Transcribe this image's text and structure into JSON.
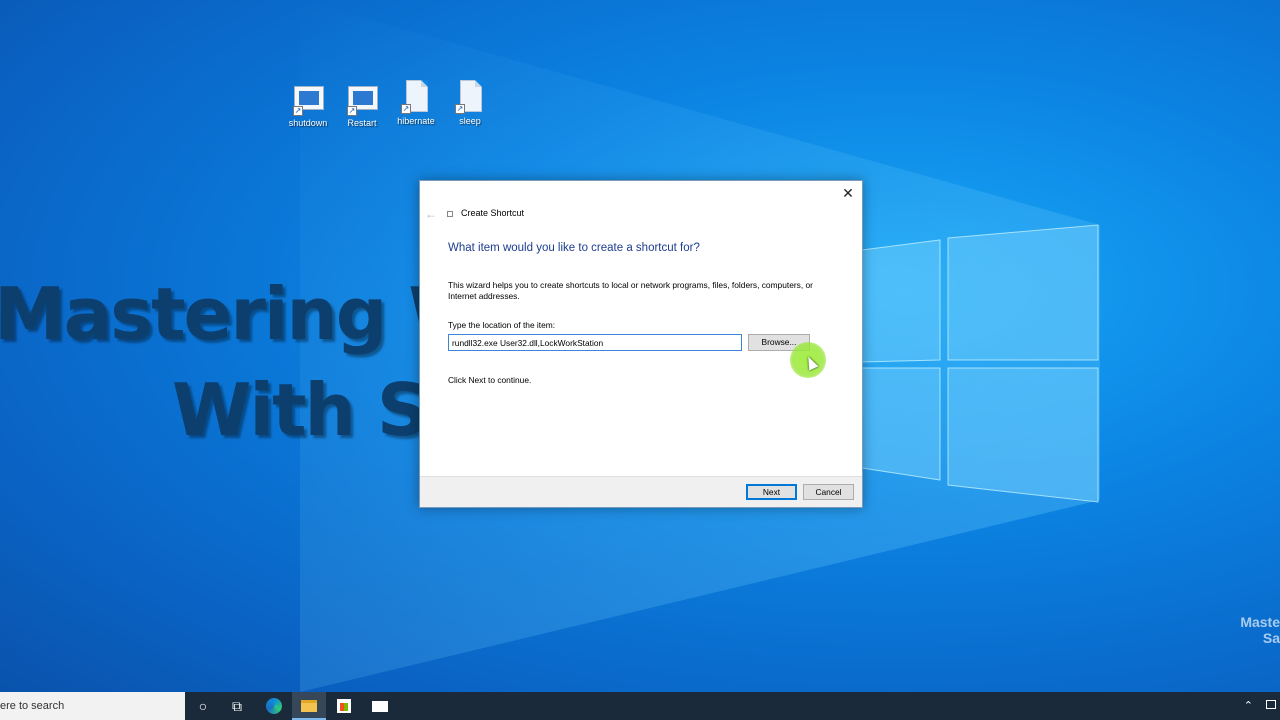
{
  "desktop": {
    "icons": [
      {
        "label": "shutdown",
        "type": "shortcut"
      },
      {
        "label": "Restart",
        "type": "shortcut"
      },
      {
        "label": "hibernate",
        "type": "file"
      },
      {
        "label": "sleep",
        "type": "file"
      }
    ],
    "overlay_line1": "Mastering Wir",
    "overlay_line2": "With Sa",
    "watermark_line1": "Maste",
    "watermark_line2": "Sa"
  },
  "dialog": {
    "title": "Create Shortcut",
    "heading": "What item would you like to create a shortcut for?",
    "description": "This wizard helps you to create shortcuts to local or network programs, files, folders, computers, or Internet addresses.",
    "location_label": "Type the location of the item:",
    "location_value": "rundll32.exe User32.dll,LockWorkStation",
    "browse_label": "Browse...",
    "continue_text": "Click Next to continue.",
    "next_label": "Next",
    "cancel_label": "Cancel",
    "close_glyph": "✕",
    "back_glyph": "←"
  },
  "taskbar": {
    "search_text": "ere to search",
    "cortana_glyph": "○",
    "taskview_glyph": "⧉",
    "tray_glyph": "⌃"
  },
  "colors": {
    "heading": "#1e3d8f",
    "accent": "#0078d7",
    "desktop": "#0b84e3",
    "taskbar": "#1b2a3a"
  }
}
